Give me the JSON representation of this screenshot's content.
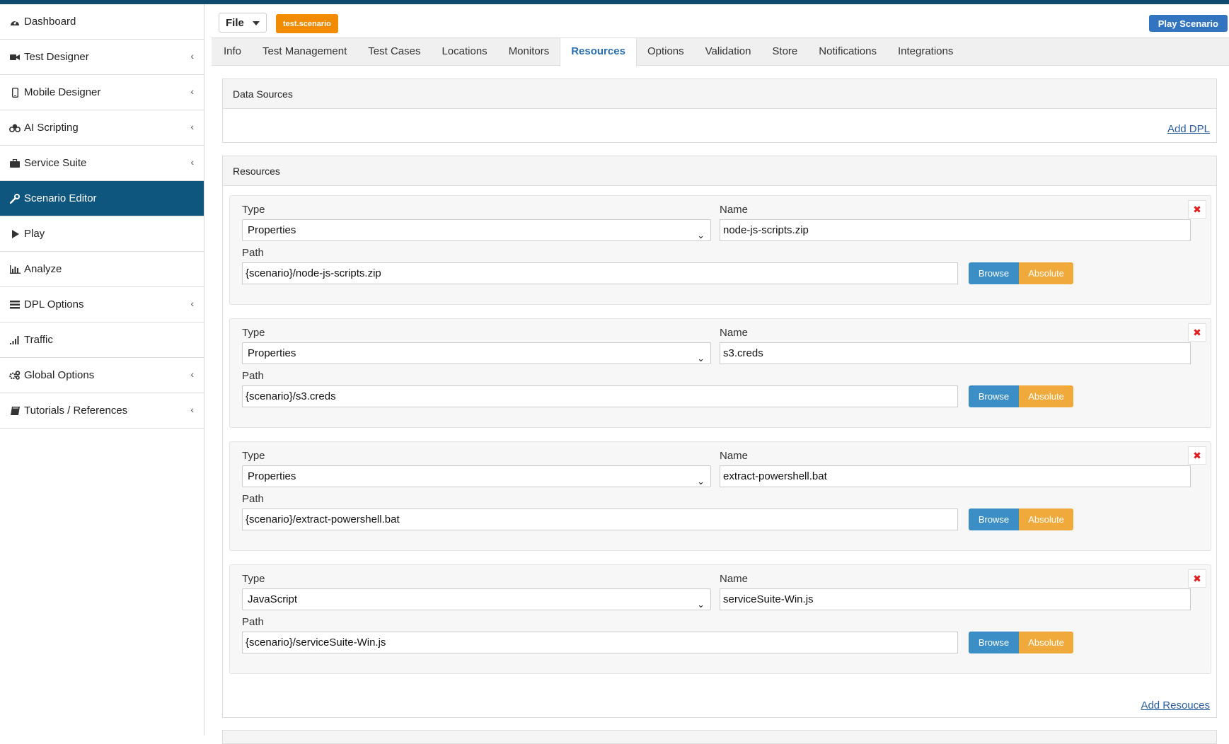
{
  "sidebar": {
    "items": [
      {
        "label": "Dashboard",
        "icon": "dashboard-icon",
        "has_chevron": false
      },
      {
        "label": "Test Designer",
        "icon": "video-camera-icon",
        "has_chevron": true
      },
      {
        "label": "Mobile Designer",
        "icon": "mobile-icon",
        "has_chevron": true
      },
      {
        "label": "AI Scripting",
        "icon": "robot-icon",
        "has_chevron": true
      },
      {
        "label": "Service Suite",
        "icon": "briefcase-icon",
        "has_chevron": true
      },
      {
        "label": "Scenario Editor",
        "icon": "wrench-icon",
        "has_chevron": false
      },
      {
        "label": "Play",
        "icon": "play-icon",
        "has_chevron": false
      },
      {
        "label": "Analyze",
        "icon": "bar-chart-icon",
        "has_chevron": false
      },
      {
        "label": "DPL Options",
        "icon": "list-icon",
        "has_chevron": true
      },
      {
        "label": "Traffic",
        "icon": "signal-icon",
        "has_chevron": false
      },
      {
        "label": "Global Options",
        "icon": "gears-icon",
        "has_chevron": true
      },
      {
        "label": "Tutorials / References",
        "icon": "book-icon",
        "has_chevron": true
      }
    ],
    "active": "Scenario Editor"
  },
  "header": {
    "file_label": "File",
    "scenario_badge": "test.scenario",
    "play_label": "Play Scenario"
  },
  "tabs": [
    "Info",
    "Test Management",
    "Test Cases",
    "Locations",
    "Monitors",
    "Resources",
    "Options",
    "Validation",
    "Store",
    "Notifications",
    "Integrations"
  ],
  "active_tab": "Resources",
  "data_sources": {
    "title": "Data Sources",
    "add_label": "Add DPL"
  },
  "resources": {
    "title": "Resources",
    "type_label": "Type",
    "name_label": "Name",
    "path_label": "Path",
    "browse_label": "Browse",
    "absolute_label": "Absolute",
    "delete_glyph": "✖",
    "add_label": "Add Resouces",
    "items": [
      {
        "type": "Properties",
        "name": "node-js-scripts.zip",
        "path": "{scenario}/node-js-scripts.zip"
      },
      {
        "type": "Properties",
        "name": "s3.creds",
        "path": "{scenario}/s3.creds"
      },
      {
        "type": "Properties",
        "name": "extract-powershell.bat",
        "path": "{scenario}/extract-powershell.bat"
      },
      {
        "type": "JavaScript",
        "name": "serviceSuite-Win.js",
        "path": "{scenario}/serviceSuite-Win.js"
      }
    ]
  },
  "colors": {
    "brand_dark": "#0f4b6e",
    "active_sidebar": "#0f567e",
    "badge_orange": "#f28b00",
    "play_blue": "#3374c1",
    "browse_blue": "#3b8fc6",
    "absolute_orange": "#f0a93b",
    "delete_red": "#e02020"
  }
}
